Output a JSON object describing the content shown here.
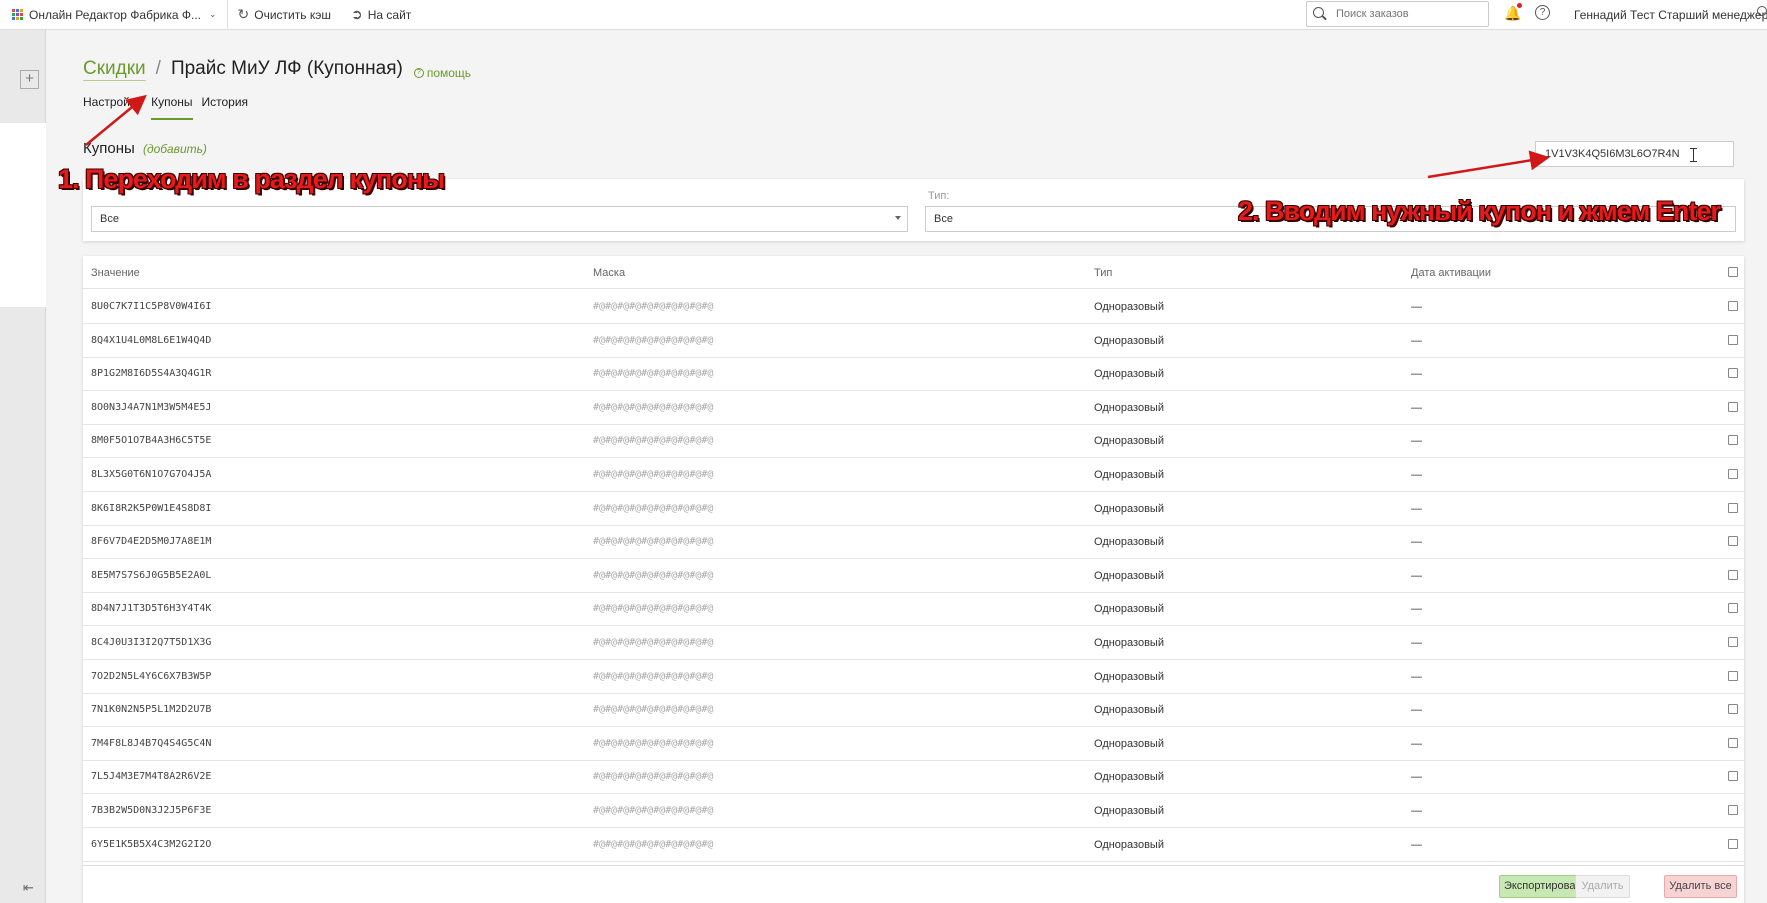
{
  "topbar": {
    "app_name": "Онлайн Редактор Фабрика Ф...",
    "clear_cache": "Очистить кэш",
    "to_site": "На сайт",
    "search_placeholder": "Поиск заказов",
    "user": "Геннадий Тест Старший менеджер"
  },
  "header": {
    "breadcrumb_link": "Скидки",
    "separator": "/",
    "title": "Прайс МиУ ЛФ (Купонная)",
    "help": "помощь"
  },
  "tabs": [
    "Настройка",
    "Купоны",
    "История"
  ],
  "section": {
    "title": "Купоны",
    "add": "(добавить)",
    "coupon_search_value": "1V1V3K4Q5I6M3L6O7R4N"
  },
  "filters": {
    "type_label": "Тип:",
    "select1_value": "Все",
    "select2_value": "Все"
  },
  "table": {
    "headers": [
      "Значение",
      "Маска",
      "Тип",
      "Дата активации"
    ],
    "rows": [
      {
        "value": "8U0C7K7I1C5P8V0W4I6I",
        "mask": "#@#@#@#@#@#@#@#@#@#@",
        "type": "Одноразовый",
        "date": "—"
      },
      {
        "value": "8Q4X1U4L0M8L6E1W4Q4D",
        "mask": "#@#@#@#@#@#@#@#@#@#@",
        "type": "Одноразовый",
        "date": "—"
      },
      {
        "value": "8P1G2M8I6D5S4A3Q4G1R",
        "mask": "#@#@#@#@#@#@#@#@#@#@",
        "type": "Одноразовый",
        "date": "—"
      },
      {
        "value": "8O0N3J4A7N1M3W5M4E5J",
        "mask": "#@#@#@#@#@#@#@#@#@#@",
        "type": "Одноразовый",
        "date": "—"
      },
      {
        "value": "8M0F5O1O7B4A3H6C5T5E",
        "mask": "#@#@#@#@#@#@#@#@#@#@",
        "type": "Одноразовый",
        "date": "—"
      },
      {
        "value": "8L3X5G0T6N1O7G7O4J5A",
        "mask": "#@#@#@#@#@#@#@#@#@#@",
        "type": "Одноразовый",
        "date": "—"
      },
      {
        "value": "8K6I8R2K5P0W1E4S8D8I",
        "mask": "#@#@#@#@#@#@#@#@#@#@",
        "type": "Одноразовый",
        "date": "—"
      },
      {
        "value": "8F6V7D4E2D5M0J7A8E1M",
        "mask": "#@#@#@#@#@#@#@#@#@#@",
        "type": "Одноразовый",
        "date": "—"
      },
      {
        "value": "8E5M7S7S6J0G5B5E2A0L",
        "mask": "#@#@#@#@#@#@#@#@#@#@",
        "type": "Одноразовый",
        "date": "—"
      },
      {
        "value": "8D4N7J1T3D5T6H3Y4T4K",
        "mask": "#@#@#@#@#@#@#@#@#@#@",
        "type": "Одноразовый",
        "date": "—"
      },
      {
        "value": "8C4J0U3I3I2Q7T5D1X3G",
        "mask": "#@#@#@#@#@#@#@#@#@#@",
        "type": "Одноразовый",
        "date": "—"
      },
      {
        "value": "7O2D2N5L4Y6C6X7B3W5P",
        "mask": "#@#@#@#@#@#@#@#@#@#@",
        "type": "Одноразовый",
        "date": "—"
      },
      {
        "value": "7N1K0N2N5P5L1M2D2U7B",
        "mask": "#@#@#@#@#@#@#@#@#@#@",
        "type": "Одноразовый",
        "date": "—"
      },
      {
        "value": "7M4F8L8J4B7Q4S4G5C4N",
        "mask": "#@#@#@#@#@#@#@#@#@#@",
        "type": "Одноразовый",
        "date": "—"
      },
      {
        "value": "7L5J4M3E7M4T8A2R6V2E",
        "mask": "#@#@#@#@#@#@#@#@#@#@",
        "type": "Одноразовый",
        "date": "—"
      },
      {
        "value": "7B3B2W5D0N3J2J5P6F3E",
        "mask": "#@#@#@#@#@#@#@#@#@#@",
        "type": "Одноразовый",
        "date": "—"
      },
      {
        "value": "6Y5E1K5B5X4C3M2G2I2O",
        "mask": "#@#@#@#@#@#@#@#@#@#@",
        "type": "Одноразовый",
        "date": "—"
      }
    ]
  },
  "footer": {
    "export": "Экспортировать",
    "delete": "Удалить",
    "delete_all": "Удалить все"
  },
  "annotations": {
    "step1": "1. Переходим в раздел купоны",
    "step2": "2. Вводим нужный купон и жмем  Enter"
  },
  "colors": {
    "accent": "#6b9a2f",
    "annotation": "#e31b1b",
    "export_bg": "#c7e8b3",
    "delete_all_bg": "#f8d3d3"
  },
  "icons": [
    "apps-grid-icon",
    "refresh-icon",
    "go-to-site-icon",
    "search-icon",
    "bell-icon",
    "help-icon",
    "user-icon",
    "plus-icon",
    "collapse-icon",
    "chevron-down-icon"
  ]
}
